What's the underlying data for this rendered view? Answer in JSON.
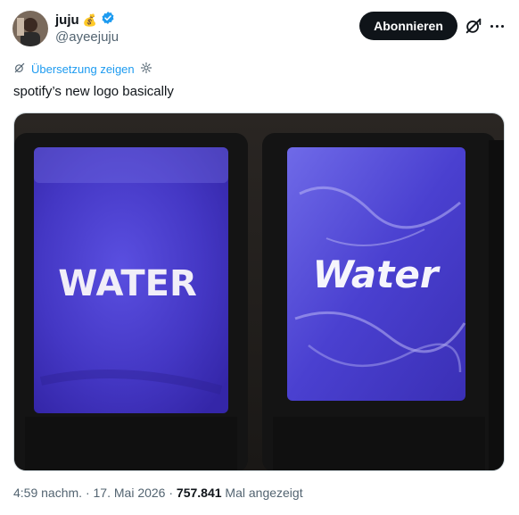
{
  "author": {
    "name": "juju",
    "name_emoji": "💰",
    "handle": "@ayeejuju",
    "verified": true
  },
  "actions": {
    "follow_label": "Abonnieren",
    "grok_icon": "grok-icon",
    "more_icon": "more-icon"
  },
  "translate": {
    "label": "Übersetzung zeigen",
    "icon": "translate-icon",
    "settings_icon": "gear-icon"
  },
  "tweet": {
    "text": "spotify’s new logo basically"
  },
  "media": {
    "left_sign": "WATER",
    "right_sign": "Water",
    "colors": {
      "sign_blue": "#4b3fc9",
      "frame": "#151515"
    }
  },
  "meta": {
    "time": "4:59 nachm.",
    "separator1": " · ",
    "date": "17. Mai 2026",
    "separator2": " · ",
    "views": "757.841",
    "views_label": " Mal angezeigt"
  },
  "colors": {
    "accent": "#1d9bf0",
    "text": "#0f1419",
    "secondary": "#536471",
    "verified": "#1d9bf0"
  }
}
